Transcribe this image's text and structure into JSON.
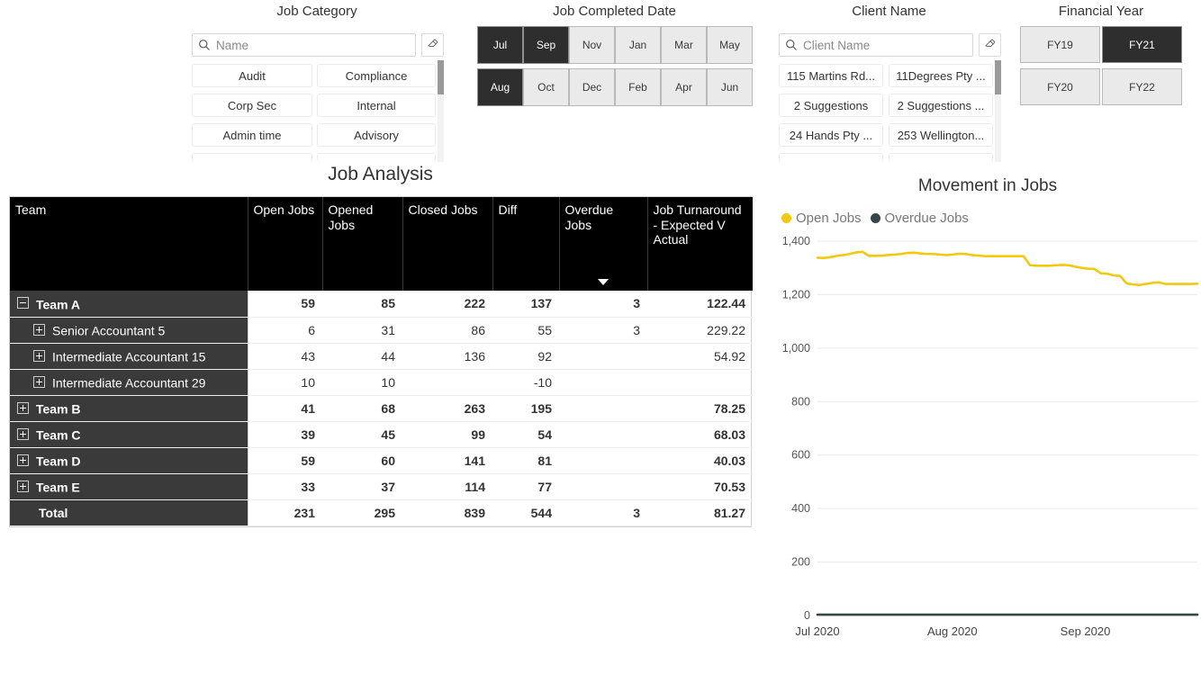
{
  "slicers": {
    "job_category": {
      "title": "Job Category",
      "search_placeholder": "Name",
      "clear_icon": "eraser-icon",
      "search_icon": "search-icon",
      "items": [
        "Audit",
        "Compliance",
        "Corp Sec",
        "Internal",
        "Admin time",
        "Advisory"
      ]
    },
    "job_completed_date": {
      "title": "Job Completed Date",
      "months_row1": [
        "Jul",
        "Sep",
        "Nov",
        "Jan",
        "Mar",
        "May"
      ],
      "months_row2": [
        "Aug",
        "Oct",
        "Dec",
        "Feb",
        "Apr",
        "Jun"
      ],
      "selected": [
        "Jul",
        "Sep",
        "Aug"
      ]
    },
    "client_name": {
      "title": "Client Name",
      "search_placeholder": "Client Name",
      "clear_icon": "eraser-icon",
      "search_icon": "search-icon",
      "items": [
        "115 Martins Rd...",
        "11Degrees Pty ...",
        "2 Suggestions",
        "2 Suggestions ...",
        "24 Hands Pty ...",
        "253 Wellington..."
      ]
    },
    "financial_year": {
      "title": "Financial Year",
      "items": [
        "FY19",
        "FY21",
        "FY20",
        "FY22"
      ],
      "selected": [
        "FY21"
      ]
    }
  },
  "matrix": {
    "title": "Job Analysis",
    "columns": [
      "Team",
      "Open Jobs",
      "Opened Jobs",
      "Closed Jobs",
      "Diff",
      "Overdue Jobs",
      "Job Turnaround - Expected V Actual"
    ],
    "sorted_column": "Overdue Jobs",
    "sort_direction": "descending",
    "rows": [
      {
        "label": "Team A",
        "level": 0,
        "expanded": true,
        "bold": true,
        "open": "59",
        "opened": "85",
        "closed": "222",
        "diff": "137",
        "overdue": "3",
        "turnaround": "122.44"
      },
      {
        "label": "Senior Accountant 5",
        "level": 1,
        "expanded": false,
        "bold": false,
        "open": "6",
        "opened": "31",
        "closed": "86",
        "diff": "55",
        "overdue": "3",
        "turnaround": "229.22"
      },
      {
        "label": "Intermediate Accountant 15",
        "level": 1,
        "expanded": false,
        "bold": false,
        "open": "43",
        "opened": "44",
        "closed": "136",
        "diff": "92",
        "overdue": "",
        "turnaround": "54.92"
      },
      {
        "label": "Intermediate Accountant 29",
        "level": 1,
        "expanded": false,
        "bold": false,
        "open": "10",
        "opened": "10",
        "closed": "",
        "diff": "-10",
        "overdue": "",
        "turnaround": ""
      },
      {
        "label": "Team B",
        "level": 0,
        "expanded": false,
        "bold": true,
        "open": "41",
        "opened": "68",
        "closed": "263",
        "diff": "195",
        "overdue": "",
        "turnaround": "78.25"
      },
      {
        "label": "Team C",
        "level": 0,
        "expanded": false,
        "bold": true,
        "open": "39",
        "opened": "45",
        "closed": "99",
        "diff": "54",
        "overdue": "",
        "turnaround": "68.03"
      },
      {
        "label": "Team D",
        "level": 0,
        "expanded": false,
        "bold": true,
        "open": "59",
        "opened": "60",
        "closed": "141",
        "diff": "81",
        "overdue": "",
        "turnaround": "40.03"
      },
      {
        "label": "Team E",
        "level": 0,
        "expanded": false,
        "bold": true,
        "open": "33",
        "opened": "37",
        "closed": "114",
        "diff": "77",
        "overdue": "",
        "turnaround": "70.53"
      }
    ],
    "total": {
      "label": "Total",
      "open": "231",
      "opened": "295",
      "closed": "839",
      "diff": "544",
      "overdue": "3",
      "turnaround": "81.27"
    }
  },
  "chart_data": {
    "type": "line",
    "title": "Movement in Jobs",
    "xlabel": "",
    "ylabel": "",
    "ylim": [
      0,
      1400
    ],
    "yticks": [
      0,
      200,
      400,
      600,
      800,
      1000,
      1200,
      1400
    ],
    "ytick_labels": [
      "0",
      "200",
      "400",
      "600",
      "800",
      "1,000",
      "1,200",
      "1,400"
    ],
    "xtick_labels": [
      "Jul 2020",
      "Aug 2020",
      "Sep 2020"
    ],
    "xtick_positions": [
      0,
      0.355,
      0.705
    ],
    "grid": true,
    "legend_position": "top-left",
    "colors": {
      "Open Jobs": "#F2C811",
      "Overdue Jobs": "#374649"
    },
    "series": [
      {
        "name": "Open Jobs",
        "color": "#F2C811",
        "values": [
          1338,
          1337,
          1340,
          1345,
          1348,
          1352,
          1358,
          1360,
          1345,
          1345,
          1346,
          1348,
          1350,
          1352,
          1356,
          1357,
          1354,
          1352,
          1352,
          1350,
          1348,
          1350,
          1353,
          1352,
          1348,
          1346,
          1344,
          1344,
          1344,
          1344,
          1344,
          1344,
          1344,
          1310,
          1308,
          1308,
          1308,
          1310,
          1311,
          1310,
          1305,
          1300,
          1297,
          1296,
          1280,
          1278,
          1272,
          1270,
          1242,
          1238,
          1236,
          1240,
          1244,
          1246,
          1240,
          1240,
          1240,
          1240,
          1240,
          1241
        ]
      },
      {
        "name": "Overdue Jobs",
        "color": "#374649",
        "values": [
          3,
          3,
          3,
          3,
          3,
          3,
          3,
          3,
          3,
          3,
          3,
          3,
          3,
          3,
          3,
          3,
          3,
          3,
          3,
          3,
          3,
          3,
          3,
          3,
          3,
          3,
          3,
          3,
          3,
          3,
          3,
          3,
          3,
          3,
          3,
          3,
          3,
          3,
          3,
          3,
          3,
          3,
          3,
          3,
          3,
          3,
          3,
          3,
          3,
          3,
          3,
          3,
          3,
          3,
          3,
          3,
          3,
          3,
          3,
          3
        ]
      }
    ]
  }
}
